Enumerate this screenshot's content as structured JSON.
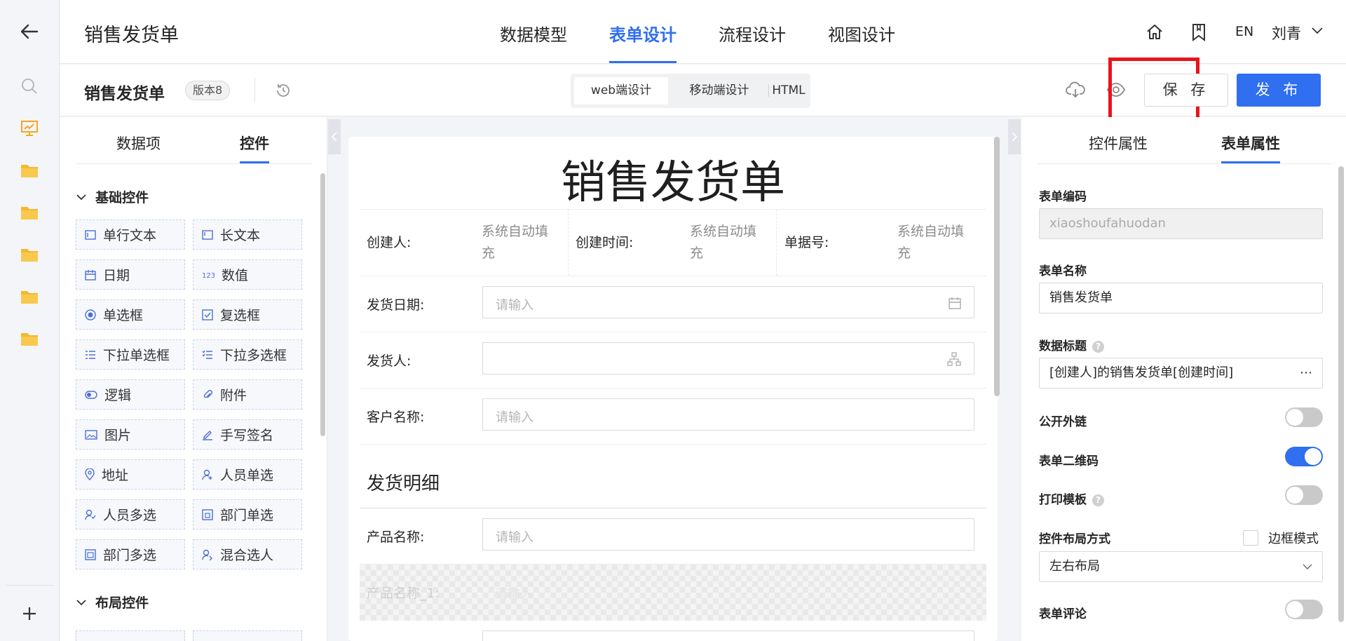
{
  "app": {
    "title": "销售发货单"
  },
  "nav": {
    "tabs": [
      "数据模型",
      "表单设计",
      "流程设计",
      "视图设计"
    ],
    "active_index": 1
  },
  "header_right": {
    "lang": "EN",
    "user": "刘青"
  },
  "form_bar": {
    "name": "销售发货单",
    "version": "版本8",
    "segments": [
      "web端设计",
      "移动端设计",
      "HTML"
    ],
    "save": "保 存",
    "publish": "发 布"
  },
  "left_panel": {
    "tabs": [
      "数据项",
      "控件"
    ],
    "active_tab": 1,
    "group_basic": "基础控件",
    "group_layout": "布局控件",
    "controls": [
      {
        "label": "单行文本",
        "icon": "single-line-text-icon"
      },
      {
        "label": "长文本",
        "icon": "long-text-icon"
      },
      {
        "label": "日期",
        "icon": "date-icon"
      },
      {
        "label": "数值",
        "icon": "number-icon"
      },
      {
        "label": "单选框",
        "icon": "radio-icon"
      },
      {
        "label": "复选框",
        "icon": "checkbox-icon"
      },
      {
        "label": "下拉单选框",
        "icon": "dropdown-single-icon"
      },
      {
        "label": "下拉多选框",
        "icon": "dropdown-multi-icon"
      },
      {
        "label": "逻辑",
        "icon": "toggle-logic-icon"
      },
      {
        "label": "附件",
        "icon": "paperclip-icon"
      },
      {
        "label": "图片",
        "icon": "image-icon"
      },
      {
        "label": "手写签名",
        "icon": "pen-signature-icon"
      },
      {
        "label": "地址",
        "icon": "location-pin-icon"
      },
      {
        "label": "人员单选",
        "icon": "user-add-icon"
      },
      {
        "label": "人员多选",
        "icon": "users-icon"
      },
      {
        "label": "部门单选",
        "icon": "department-icon"
      },
      {
        "label": "部门多选",
        "icon": "departments-icon"
      },
      {
        "label": "混合选人",
        "icon": "mixed-user-icon"
      }
    ]
  },
  "canvas": {
    "title": "销售发货单",
    "creator_label": "创建人:",
    "creator_value": "系统自动填充",
    "created_time_label": "创建时间:",
    "created_time_value": "系统自动填充",
    "doc_no_label": "单据号:",
    "doc_no_value": "系统自动填充",
    "ship_date_label": "发货日期:",
    "ship_date_placeholder": "请输入",
    "shipper_label": "发货人:",
    "customer_label": "客户名称:",
    "customer_placeholder": "请输入",
    "section_title": "发货明细",
    "product_label": "产品名称:",
    "product_placeholder": "请输入",
    "product1_label": "产品名称_1:",
    "product1_placeholder": "请输入"
  },
  "right_panel": {
    "tabs": [
      "控件属性",
      "表单属性"
    ],
    "active_tab": 1,
    "code_label": "表单编码",
    "code_value": "xiaoshoufahuodan",
    "name_label": "表单名称",
    "name_value": "销售发货单",
    "data_title_label": "数据标题",
    "data_title_value": "[创建人]的销售发货单[创建时间]",
    "public_link_label": "公开外链",
    "public_link_on": false,
    "qrcode_label": "表单二维码",
    "qrcode_on": true,
    "print_label": "打印模板",
    "print_on": false,
    "layout_label": "控件布局方式",
    "border_mode_label": "边框模式",
    "layout_value": "左右布局",
    "comment_label": "表单评论",
    "comment_on": false
  },
  "colors": {
    "accent": "#2f6ff0",
    "folder": "#f5b82e",
    "highlight": "#e8141b"
  }
}
